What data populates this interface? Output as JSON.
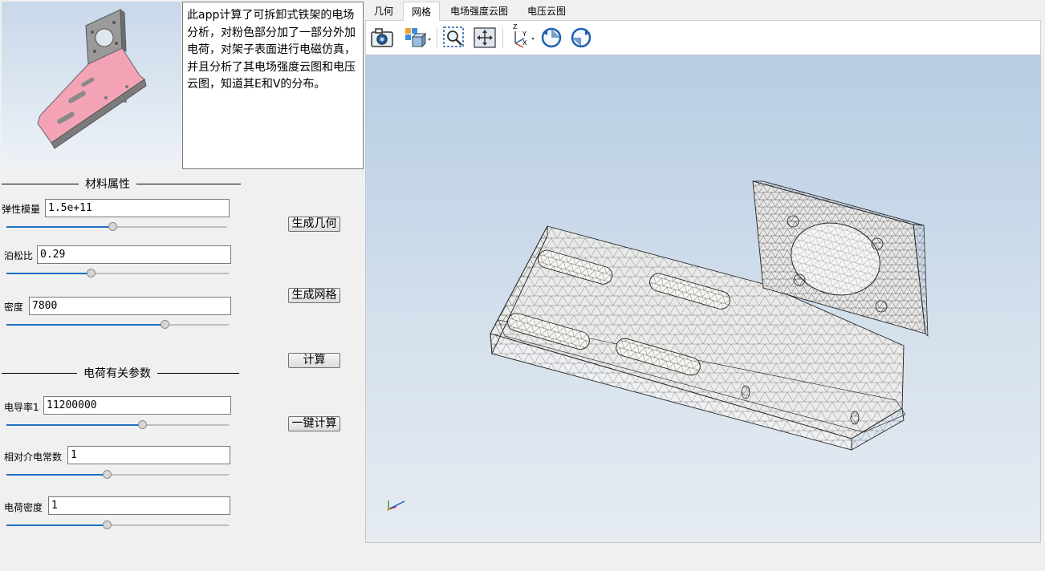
{
  "description": "此app计算了可拆卸式铁架的电场分析，对粉色部分加了一部分外加电荷，对架子表面进行电磁仿真，并且分析了其电场强度云图和电压云图，知道其E和V的分布。",
  "material_group": {
    "title": "材料属性",
    "fields": [
      {
        "label": "弹性模量",
        "value": "1.5e+11",
        "slider": 0.48
      },
      {
        "label": "泊松比",
        "value": "0.29",
        "slider": 0.38
      },
      {
        "label": "密度",
        "value": "7800",
        "slider": 0.71
      }
    ]
  },
  "charge_group": {
    "title": "电荷有关参数",
    "fields": [
      {
        "label": "电导率1",
        "value": "11200000",
        "slider": 0.61
      },
      {
        "label": "相对介电常数",
        "value": "1",
        "slider": 0.45
      },
      {
        "label": "电荷密度",
        "value": "1",
        "slider": 0.45
      }
    ]
  },
  "buttons": {
    "generate_geometry": "生成几何",
    "generate_mesh": "生成网格",
    "compute": "计算",
    "one_click_compute": "一键计算"
  },
  "tabs": [
    {
      "label": "几何",
      "active": false
    },
    {
      "label": "网格",
      "active": true
    },
    {
      "label": "电场强度云图",
      "active": false
    },
    {
      "label": "电压云图",
      "active": false
    }
  ],
  "toolbar": [
    {
      "icon": "camera-icon"
    },
    {
      "icon": "view-cube-icon"
    },
    {
      "icon": "zoom-box-icon"
    },
    {
      "icon": "fit-view-icon"
    },
    {
      "icon": "axes-icon",
      "axis_letters": [
        "Z",
        "Y",
        "X"
      ]
    },
    {
      "icon": "rotate-ccw-icon"
    },
    {
      "icon": "rotate-cw-icon"
    }
  ],
  "colors": {
    "charged_part": "#f4a3b6",
    "bracket_metal": "#8f8f8f",
    "slider_fill": "#1e6fc0",
    "viewport_top": "#b7cde4",
    "viewport_bottom": "#e6ebf2"
  }
}
